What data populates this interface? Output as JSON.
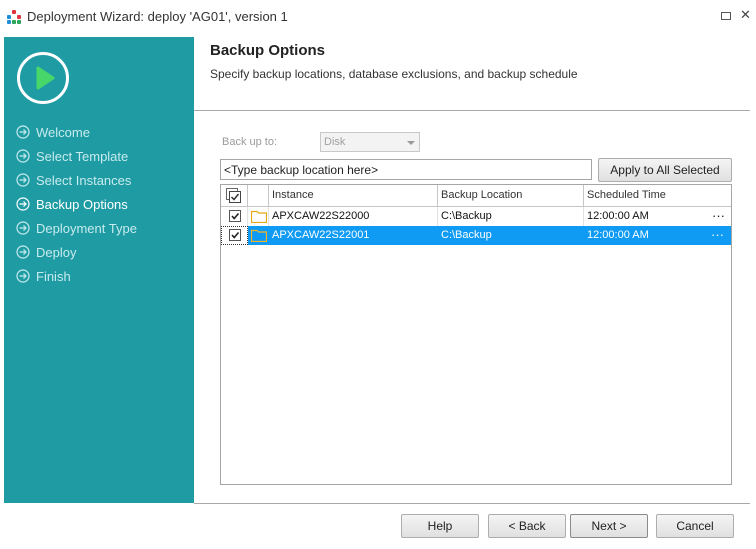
{
  "window": {
    "title": "Deployment Wizard: deploy 'AG01', version 1",
    "icons": {
      "maximize": "maximize-icon",
      "close": "close-icon",
      "close_glyph": "✕"
    }
  },
  "sidebar": {
    "color": "#1f9ba3",
    "logo": "play-icon",
    "items": [
      {
        "label": "Welcome",
        "active": false
      },
      {
        "label": "Select Template",
        "active": false
      },
      {
        "label": "Select Instances",
        "active": false
      },
      {
        "label": "Backup Options",
        "active": true
      },
      {
        "label": "Deployment Type",
        "active": false
      },
      {
        "label": "Deploy",
        "active": false
      },
      {
        "label": "Finish",
        "active": false
      }
    ]
  },
  "header": {
    "title": "Backup Options",
    "subtitle": "Specify backup locations, database exclusions, and backup schedule"
  },
  "backup": {
    "label": "Back up to:",
    "value": "Disk",
    "location_placeholder": "<Type backup location here>",
    "apply_label": "Apply to All Selected"
  },
  "grid": {
    "columns": [
      "Instance",
      "Backup Location",
      "Scheduled Time"
    ],
    "rows": [
      {
        "checked": true,
        "instance": "APXCAW22S22000",
        "location": "C:\\Backup",
        "time": "12:00:00 AM",
        "more": "···",
        "selected": false
      },
      {
        "checked": true,
        "instance": "APXCAW22S22001",
        "location": "C:\\Backup",
        "time": "12:00:00 AM",
        "more": "···",
        "selected": true
      }
    ],
    "selection_color": "#0f9af3"
  },
  "footer": {
    "help": "Help",
    "back": "< Back",
    "next": "Next >",
    "cancel": "Cancel"
  }
}
